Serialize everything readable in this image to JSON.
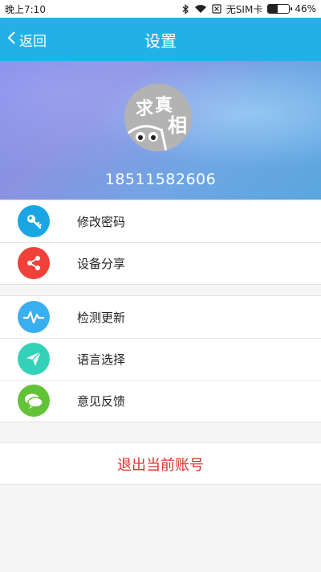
{
  "status_bar": {
    "time": "晚上7:10",
    "carrier": "无SIM卡",
    "battery": "46%",
    "battery_level": 0.46,
    "icons": [
      "bluetooth-icon",
      "wifi-icon",
      "no-sim-icon",
      "battery-icon"
    ]
  },
  "title_bar": {
    "back_label": "返回",
    "title": "设置",
    "background": "#22b1e7"
  },
  "profile": {
    "avatar_text_1": "求",
    "avatar_text_2": "真",
    "avatar_text_3": "相",
    "phone": "18511582606"
  },
  "menu_group_1": [
    {
      "label": "修改密码",
      "icon": "key-icon",
      "color": "#1aa6e5"
    },
    {
      "label": "设备分享",
      "icon": "share-icon",
      "color": "#f0403a"
    }
  ],
  "menu_group_2": [
    {
      "label": "检测更新",
      "icon": "pulse-icon",
      "color": "#39aef0"
    },
    {
      "label": "语言选择",
      "icon": "send-icon",
      "color": "#33d1b8"
    },
    {
      "label": "意见反馈",
      "icon": "chat-icon",
      "color": "#63c337"
    }
  ],
  "logout_label": "退出当前账号",
  "accent_red": "#d9332b"
}
